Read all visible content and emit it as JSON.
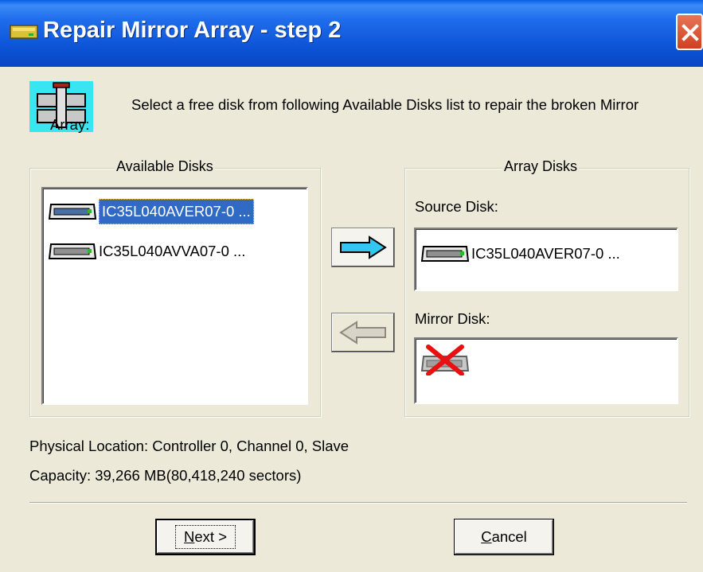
{
  "window": {
    "title": "Repair Mirror Array - step 2"
  },
  "instructions": "Select a free disk from following Available Disks list to repair the broken Mirror Array:",
  "available_disks": {
    "label": "Available Disks",
    "items": [
      {
        "name": "IC35L040AVER07-0 ...",
        "selected": true
      },
      {
        "name": "IC35L040AVVA07-0 ...",
        "selected": false
      }
    ]
  },
  "array_disks": {
    "label": "Array Disks",
    "source_label": "Source Disk:",
    "source_disk": "IC35L040AVER07-0 ...",
    "mirror_label": "Mirror Disk:",
    "mirror_disk": ""
  },
  "info": {
    "location": "Physical Location: Controller 0, Channel 0, Slave",
    "capacity": "Capacity: 39,266 MB(80,418,240 sectors)"
  },
  "buttons": {
    "next_mnemonic": "N",
    "next_rest": "ext >",
    "cancel_mnemonic": "C",
    "cancel_rest": "ancel"
  },
  "icons": {
    "window": "drive-icon",
    "app": "raid-tool-icon",
    "disk": "hard-disk-icon",
    "add_arrow": "right-arrow-icon",
    "remove_arrow": "left-arrow-icon",
    "missing_disk": "missing-disk-icon"
  },
  "colors": {
    "titlebar": "#0D54D8",
    "selection": "#316AC5",
    "dialog_bg": "#ECE9D8",
    "arrow_active": "#33C6F0"
  }
}
